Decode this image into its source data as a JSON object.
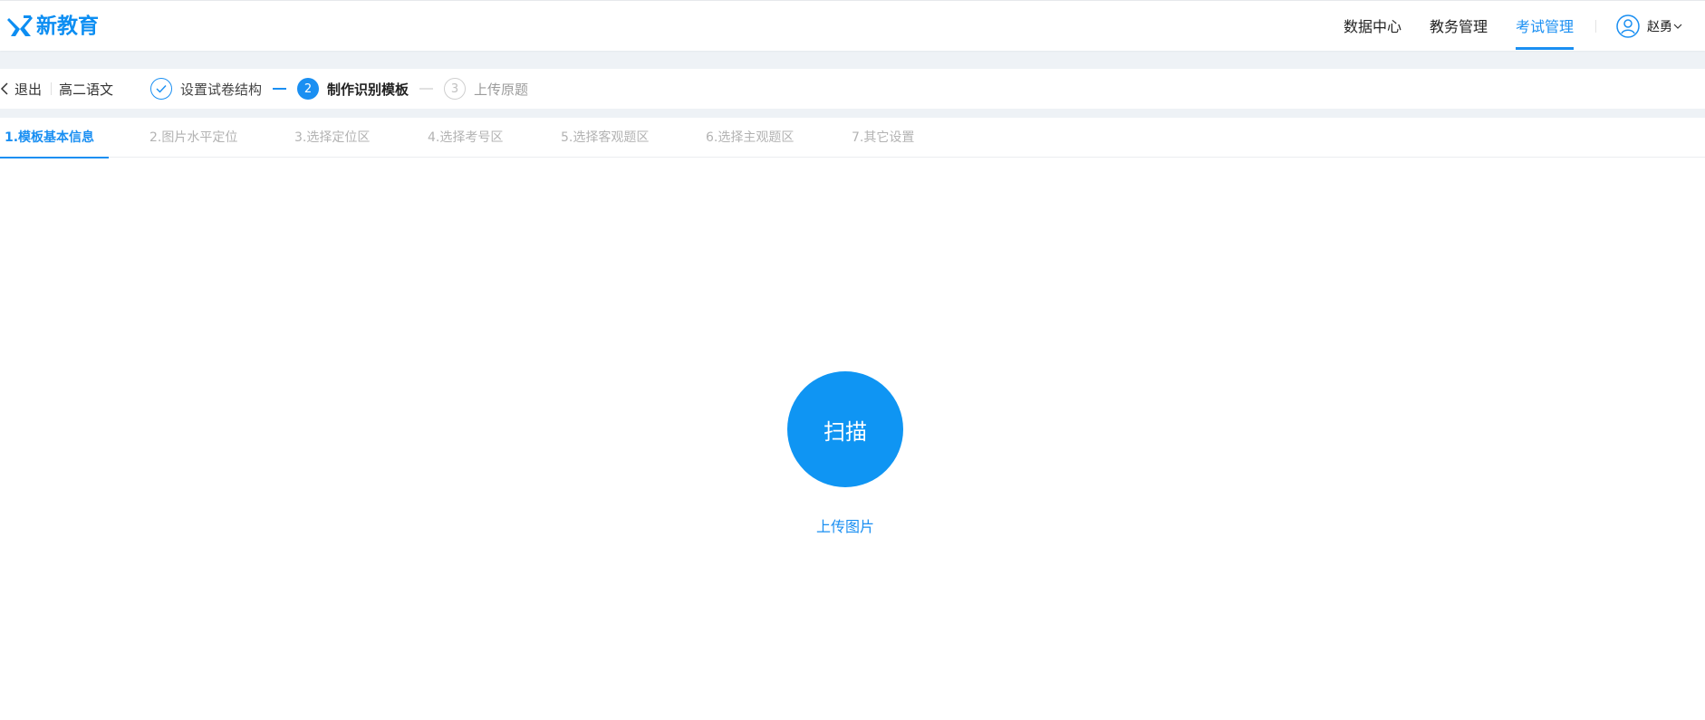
{
  "header": {
    "logo_text": "新教育",
    "nav": [
      {
        "label": "数据中心",
        "active": false
      },
      {
        "label": "教务管理",
        "active": false
      },
      {
        "label": "考试管理",
        "active": true
      }
    ],
    "user": {
      "name": "赵勇"
    },
    "accent_color": "#1a8ff2"
  },
  "stepsbar": {
    "back_label": "退出",
    "subject": "高二语文",
    "steps": [
      {
        "number": "✓",
        "label": "设置试卷结构",
        "state": "done"
      },
      {
        "number": "2",
        "label": "制作识别模板",
        "state": "current"
      },
      {
        "number": "3",
        "label": "上传原题",
        "state": "todo"
      }
    ]
  },
  "tabs": [
    {
      "label": "1.模板基本信息",
      "active": true
    },
    {
      "label": "2.图片水平定位",
      "active": false
    },
    {
      "label": "3.选择定位区",
      "active": false
    },
    {
      "label": "4.选择考号区",
      "active": false
    },
    {
      "label": "5.选择客观题区",
      "active": false
    },
    {
      "label": "6.选择主观题区",
      "active": false
    },
    {
      "label": "7.其它设置",
      "active": false
    }
  ],
  "main": {
    "scan_button_label": "扫描",
    "upload_link_label": "上传图片"
  }
}
